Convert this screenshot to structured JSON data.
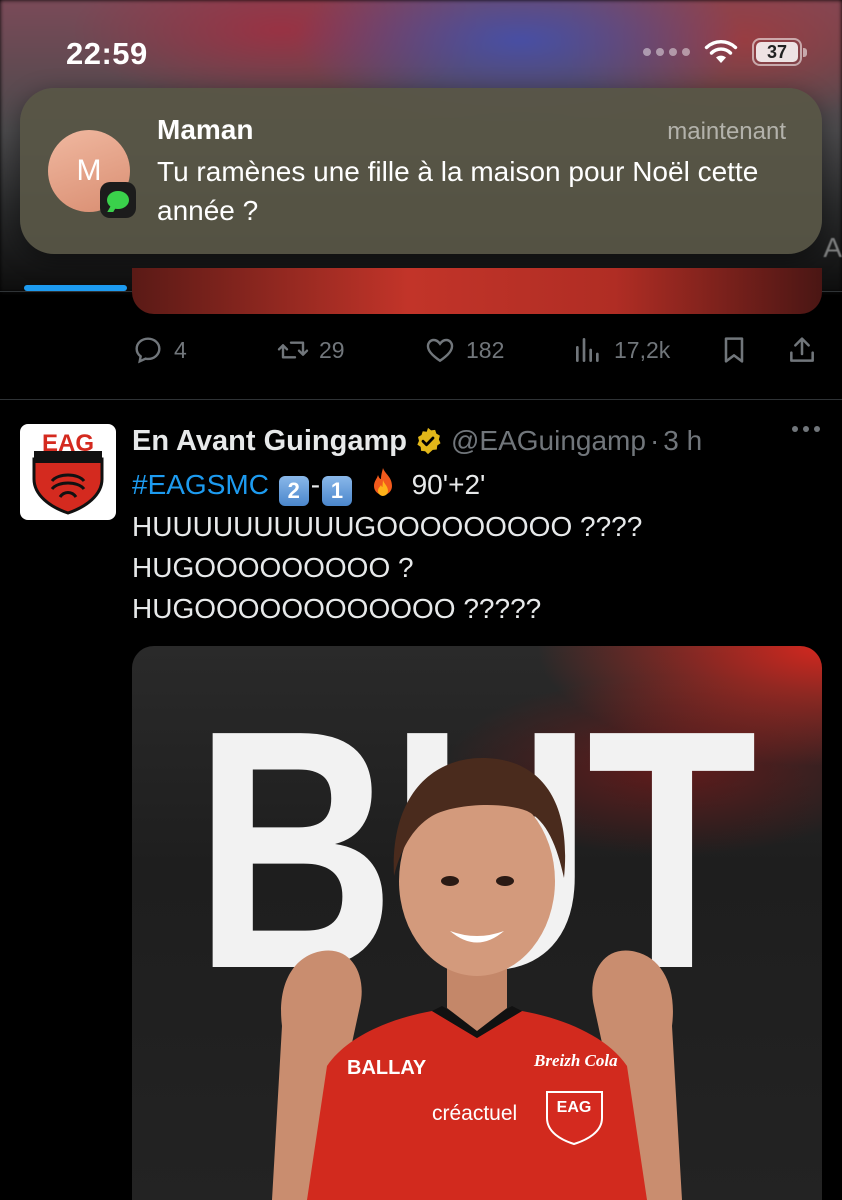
{
  "status_bar": {
    "time": "22:59",
    "battery": "37"
  },
  "notification": {
    "sender": "Maman",
    "avatar_initial": "M",
    "time": "maintenant",
    "message": "Tu ramènes une fille à la maison pour Noël cette année ?",
    "app_icon": "messages-icon"
  },
  "previous_tweet": {
    "replies": "4",
    "retweets": "29",
    "likes": "182",
    "views": "17,2k"
  },
  "tweet": {
    "author_name": "En Avant Guingamp",
    "handle": "@EAGuingamp",
    "dot": "·",
    "time": "3 h",
    "hashtag": "#EAGSMC",
    "score_home": "2",
    "score_sep": "-",
    "score_away": "1",
    "minute": "90'+2'",
    "lines": [
      "HUUUUUUUUUUGOOOOOOOOO ????",
      "HUGOOOOOOOOO ?",
      "HUGOOOOOOOOOOOO ?????"
    ],
    "media_text": "BUT",
    "logo_text": "EAG",
    "jersey_sponsors": [
      "BALLAY",
      "Breizh Cola",
      "créactuel",
      "EAG"
    ]
  },
  "colors": {
    "accent": "#1d9bf0",
    "club_red": "#d42a1f",
    "muted": "#71767b"
  }
}
